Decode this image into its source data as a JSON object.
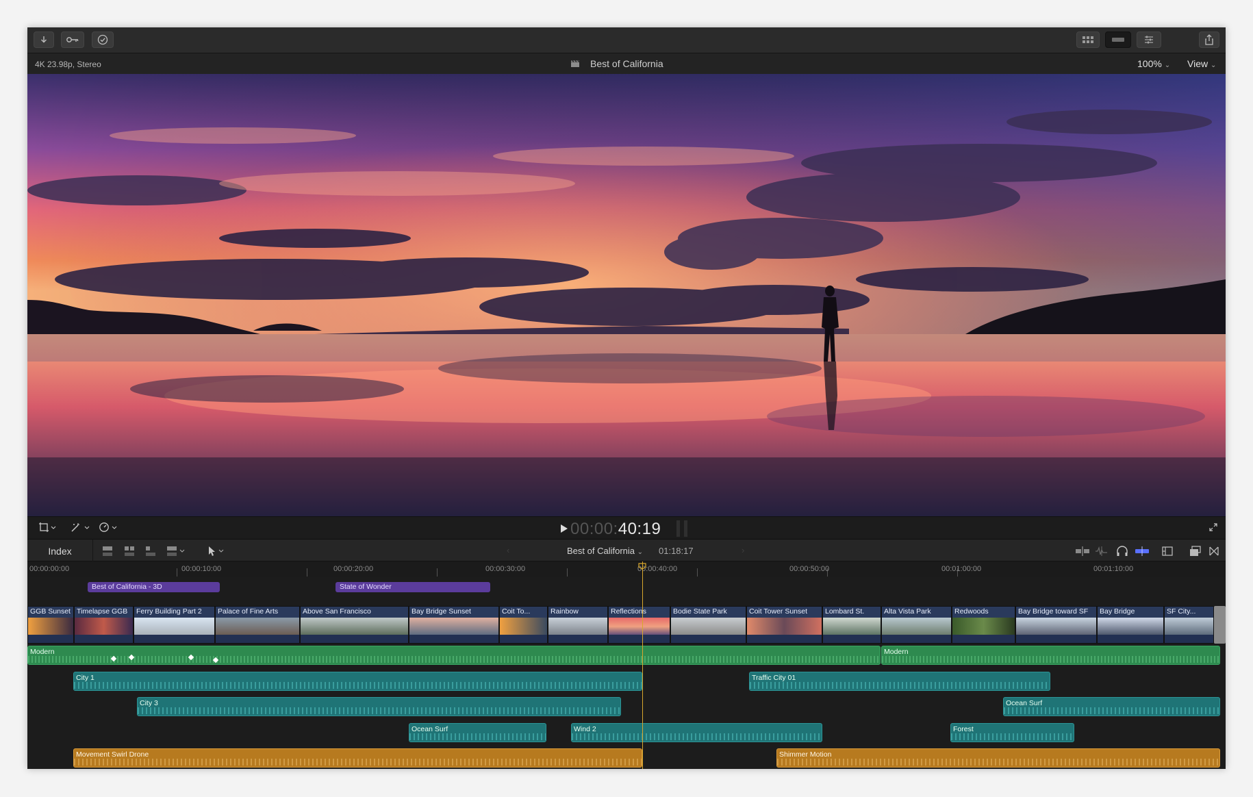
{
  "toolbar": {
    "left_icons": [
      "import-icon",
      "keywords-icon",
      "background-tasks-icon"
    ],
    "right_icons": [
      "browser-icon",
      "timeline-icon",
      "inspector-icon",
      "share-icon"
    ]
  },
  "viewer": {
    "format": "4K 23.98p, Stereo",
    "project_title": "Best of California",
    "zoom": "100%",
    "view_label": "View"
  },
  "transport": {
    "timecode_dim": "00:00:",
    "timecode": "40:19"
  },
  "timeline_header": {
    "index_label": "Index",
    "project_name": "Best of California",
    "duration": "01:18:17"
  },
  "ruler": {
    "labels": [
      "00:00:00:00",
      "00:00:10:00",
      "00:00:20:00",
      "00:00:30:00",
      "00:00:40:00",
      "00:00:50:00",
      "00:01:00:00",
      "00:01:10:00"
    ]
  },
  "timeline": {
    "titles": [
      {
        "name": "Best of California - 3D"
      },
      {
        "name": "State of Wonder"
      }
    ],
    "video_clips": [
      {
        "name": "GGB Sunset"
      },
      {
        "name": "Timelapse GGB"
      },
      {
        "name": "Ferry Building Part 2"
      },
      {
        "name": "Palace of Fine Arts"
      },
      {
        "name": "Above San Francisco"
      },
      {
        "name": "Bay Bridge Sunset"
      },
      {
        "name": "Coit To..."
      },
      {
        "name": "Rainbow"
      },
      {
        "name": "Reflections"
      },
      {
        "name": "Bodie State Park"
      },
      {
        "name": "Coit Tower Sunset"
      },
      {
        "name": "Lombard St."
      },
      {
        "name": "Alta Vista Park"
      },
      {
        "name": "Redwoods"
      },
      {
        "name": "Bay Bridge toward SF"
      },
      {
        "name": "Bay Bridge"
      },
      {
        "name": "SF City..."
      }
    ],
    "audio_clips": [
      {
        "name": "Modern",
        "color": "green"
      },
      {
        "name": "Modern",
        "color": "green"
      },
      {
        "name": "City 1",
        "color": "teal"
      },
      {
        "name": "Traffic City 01",
        "color": "teal"
      },
      {
        "name": "City 3",
        "color": "teal"
      },
      {
        "name": "Ocean Surf",
        "color": "teal"
      },
      {
        "name": "Ocean Surf",
        "color": "teal"
      },
      {
        "name": "Wind 2",
        "color": "teal"
      },
      {
        "name": "Forest",
        "color": "teal"
      },
      {
        "name": "Movement Swirl Drone",
        "color": "orange"
      },
      {
        "name": "Shimmer Motion",
        "color": "orange"
      }
    ]
  },
  "colors": {
    "purple_title": "#5b3c9c",
    "video_clip": "#2a3a5c",
    "music_green": "#2e8a4f",
    "sfx_teal": "#1f7476",
    "orange_audio": "#b77a1f",
    "playhead": "#d8a72c"
  }
}
